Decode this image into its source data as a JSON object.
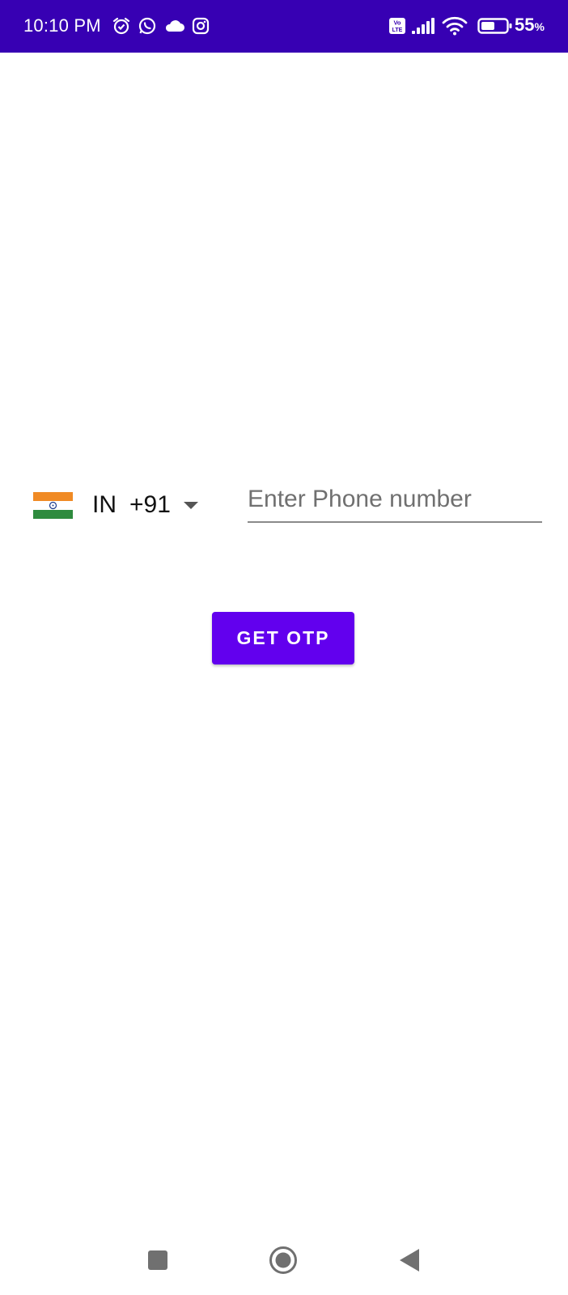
{
  "status_bar": {
    "time": "10:10 PM",
    "battery_value": "55",
    "battery_unit": "%",
    "battery_level": 0.55,
    "background_color": "#3700b3",
    "icons": [
      "alarm-icon",
      "whatsapp-icon",
      "cloud-icon",
      "instagram-icon",
      "volte-icon",
      "signal-icon",
      "wifi-icon",
      "battery-icon"
    ]
  },
  "login": {
    "country": {
      "flag": "india-flag-icon",
      "code": "IN",
      "dial_code": "+91",
      "dropdown_icon": "dropdown-arrow-icon"
    },
    "phone": {
      "placeholder": "Enter Phone number",
      "value": ""
    },
    "button": {
      "label": "GET OTP",
      "color": "#6200ee"
    }
  },
  "nav_bar": {
    "items": [
      "recents-button",
      "home-button",
      "back-button"
    ]
  }
}
